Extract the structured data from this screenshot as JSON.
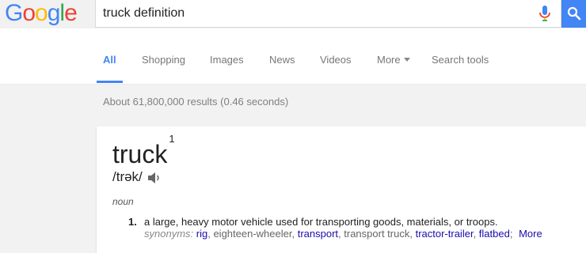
{
  "logo": {
    "letters": [
      "G",
      "o",
      "o",
      "g",
      "l",
      "e"
    ],
    "colors": [
      "#4285f4",
      "#ea4335",
      "#fbbc05",
      "#4285f4",
      "#34a853",
      "#ea4335"
    ]
  },
  "search": {
    "query": "truck definition"
  },
  "nav": {
    "tabs": [
      {
        "label": "All",
        "active": true
      },
      {
        "label": "Shopping"
      },
      {
        "label": "Images"
      },
      {
        "label": "News"
      },
      {
        "label": "Videos"
      },
      {
        "label": "More"
      },
      {
        "label": "Search tools"
      }
    ]
  },
  "stats": "About 61,800,000 results (0.46 seconds)",
  "dictionary": {
    "word": "truck",
    "sense_index": "1",
    "pronunciation": "/trək/",
    "part_of_speech": "noun",
    "definitions": [
      {
        "number": "1.",
        "text": "a large, heavy motor vehicle used for transporting goods, materials, or troops.",
        "synonyms_label": "synonyms:",
        "synonyms": [
          {
            "text": "rig",
            "link": true
          },
          {
            "text": "eighteen-wheeler",
            "link": false
          },
          {
            "text": "transport",
            "link": true
          },
          {
            "text": "transport truck",
            "link": false
          },
          {
            "text": "tractor-trailer",
            "link": true
          },
          {
            "text": "flatbed",
            "link": true
          }
        ],
        "more_label": "More"
      }
    ]
  },
  "colors": {
    "accent": "#4285f4",
    "link": "#1a0dab",
    "muted": "#777777"
  }
}
